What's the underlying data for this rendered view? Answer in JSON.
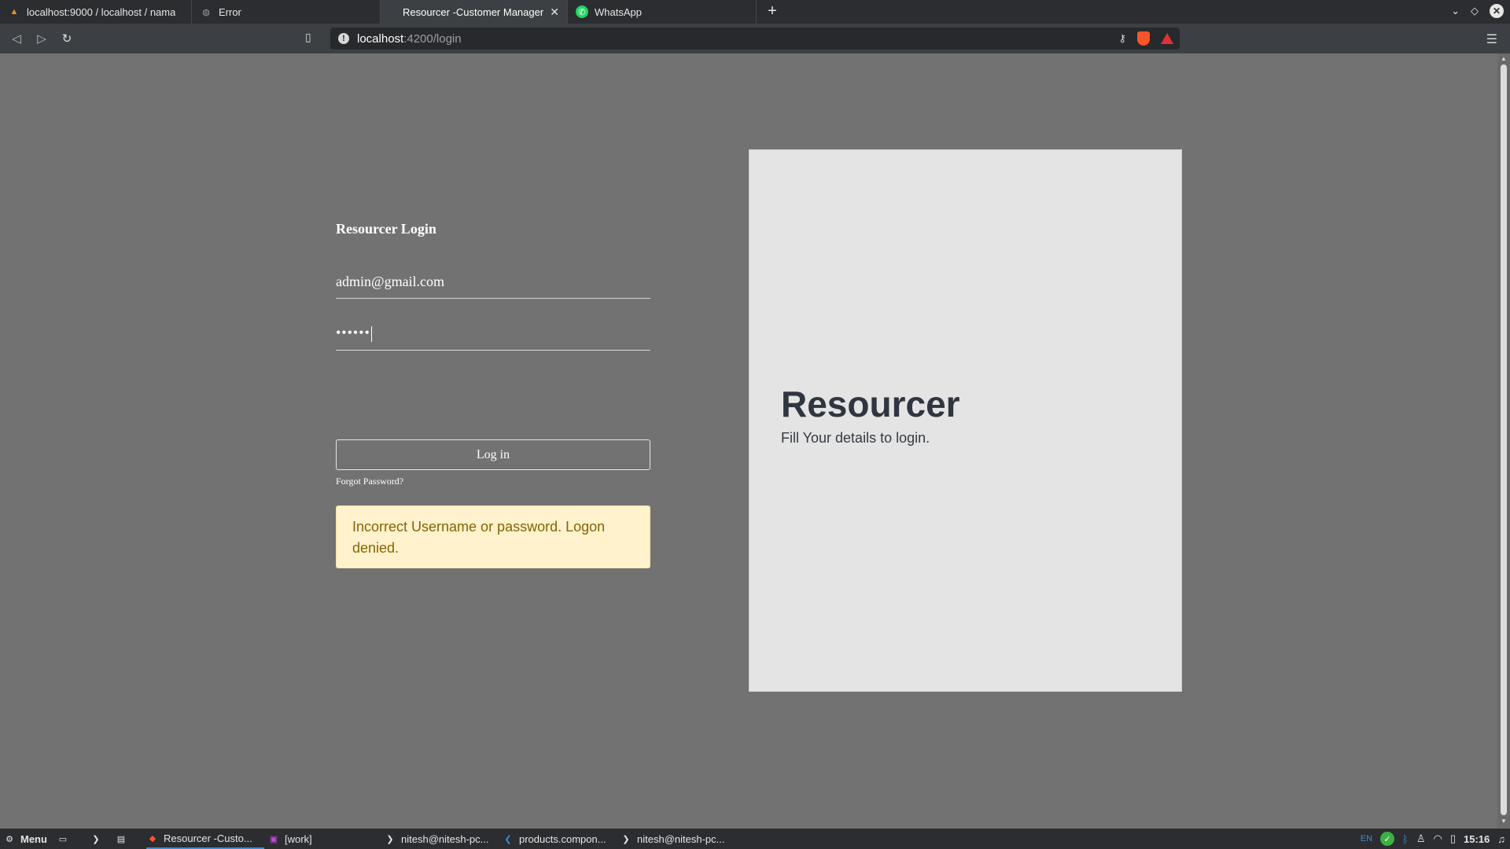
{
  "browser": {
    "tabs": [
      {
        "label": "localhost:9000 / localhost / nama",
        "icon": "pma-icon"
      },
      {
        "label": "Error",
        "icon": "globe-icon"
      },
      {
        "label": "Resourcer -Customer Manager",
        "icon": "none"
      },
      {
        "label": "WhatsApp",
        "icon": "whatsapp-icon"
      }
    ],
    "url_host": "localhost",
    "url_path": ":4200/login"
  },
  "login": {
    "title": "Resourcer Login",
    "email_value": "admin@gmail.com",
    "password_mask": "••••••",
    "button_label": "Log in",
    "forgot_label": "Forgot Password?",
    "error_message": "Incorrect Username or password. Logon denied."
  },
  "side": {
    "title": "Resourcer",
    "subtitle": "Fill Your details to login."
  },
  "taskbar": {
    "menu_label": "Menu",
    "items": [
      {
        "label": "Resourcer -Custo..."
      },
      {
        "label": "[work]"
      },
      {
        "label": "nitesh@nitesh-pc..."
      },
      {
        "label": "products.compon..."
      },
      {
        "label": "nitesh@nitesh-pc..."
      }
    ],
    "lang": "EN",
    "clock": "15:16"
  },
  "colors": {
    "page_bg": "#727272",
    "panel_bg": "#e4e4e4",
    "alert_bg": "#fff2cc",
    "alert_text": "#856404"
  }
}
